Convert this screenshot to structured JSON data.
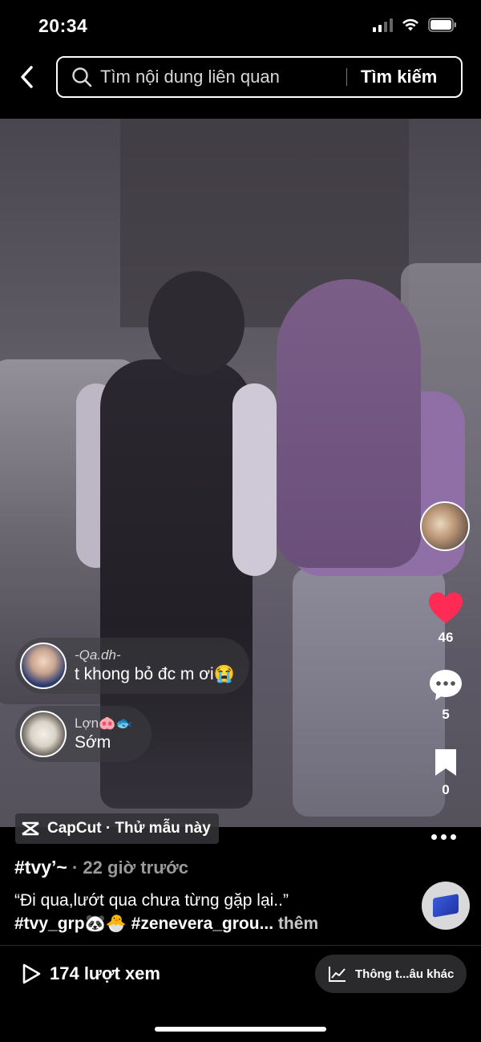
{
  "status_bar": {
    "time": "20:34"
  },
  "header": {
    "search_placeholder": "Tìm nội dung liên quan",
    "search_button": "Tìm kiếm"
  },
  "rail": {
    "likes": "46",
    "comments": "5",
    "saves": "0",
    "like_color": "#fe2c55"
  },
  "comments_overlay": [
    {
      "name": "-Qa.dh-",
      "text": "t khong bỏ đc m ơi😭"
    },
    {
      "name": "Lợn🐽🐟",
      "text": "Sớm"
    }
  ],
  "template": {
    "label": "CapCut · Thử mẫu này"
  },
  "post": {
    "author": "#tvy’~",
    "time": "· 22 giờ trước",
    "caption": "“Đi qua,lướt qua chưa từng gặp lại..”",
    "tags": "#tvy_grp🐼🐣 #zenevera_grou...",
    "more": "thêm"
  },
  "footer": {
    "views": "174 lượt xem",
    "more_info": "Thông t...âu khác"
  }
}
